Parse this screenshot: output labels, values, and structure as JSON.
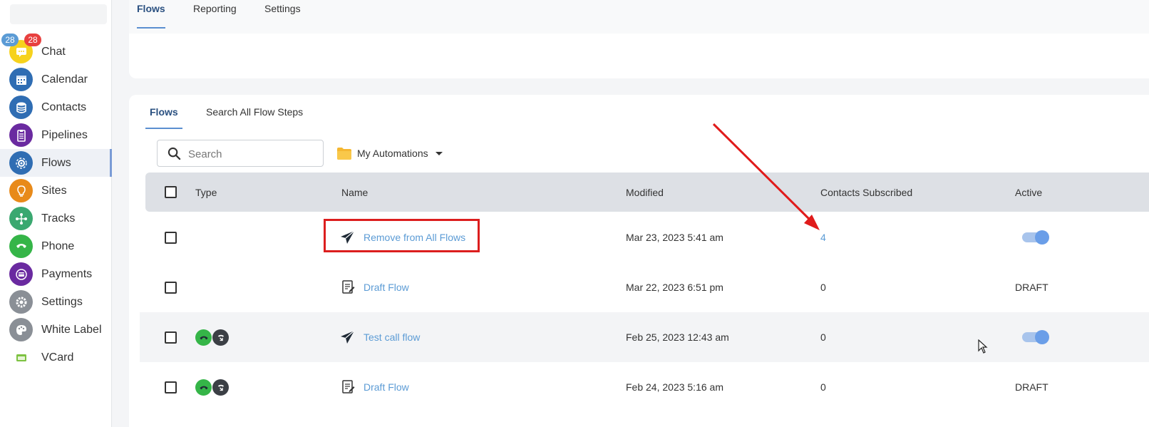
{
  "colors": {
    "accent": "#5b9bd5",
    "highlight": "#dc1e1e",
    "badge_red": "#e8403f",
    "badge_blue": "#5b9bd5"
  },
  "sidebar": {
    "badges": {
      "left": "28",
      "right": "28"
    },
    "items": [
      {
        "label": "Chat",
        "icon": "chat-icon",
        "color": "#f6d21d"
      },
      {
        "label": "Calendar",
        "icon": "calendar-icon",
        "color": "#2f6db3"
      },
      {
        "label": "Contacts",
        "icon": "database-icon",
        "color": "#2f6db3"
      },
      {
        "label": "Pipelines",
        "icon": "clipboard-icon",
        "color": "#6a2aa0"
      },
      {
        "label": "Flows",
        "icon": "gear-flow-icon",
        "color": "#2f6db3"
      },
      {
        "label": "Sites",
        "icon": "lightbulb-icon",
        "color": "#e88a1a"
      },
      {
        "label": "Tracks",
        "icon": "network-icon",
        "color": "#3aa870"
      },
      {
        "label": "Phone",
        "icon": "phone-icon",
        "color": "#35b548"
      },
      {
        "label": "Payments",
        "icon": "payment-icon",
        "color": "#6a2aa0"
      },
      {
        "label": "Settings",
        "icon": "settings-icon",
        "color": "#8a8f96"
      },
      {
        "label": "White Label",
        "icon": "palette-icon",
        "color": "#8a8f96"
      },
      {
        "label": "VCard",
        "icon": "card-icon",
        "color": "#7dc242"
      }
    ],
    "active_index": 4
  },
  "top_tabs": [
    {
      "label": "Flows",
      "active": true
    },
    {
      "label": "Reporting",
      "active": false
    },
    {
      "label": "Settings",
      "active": false
    }
  ],
  "sub_tabs": [
    {
      "label": "Flows",
      "active": true
    },
    {
      "label": "Search All Flow Steps",
      "active": false
    }
  ],
  "search": {
    "placeholder": "Search"
  },
  "folder": {
    "label": "My Automations"
  },
  "table": {
    "headers": [
      "Type",
      "Name",
      "Modified",
      "Contacts Subscribed",
      "Active"
    ],
    "rows": [
      {
        "type_icons": [],
        "name_icon": "send-icon",
        "name": "Remove from All Flows",
        "modified": "Mar 23, 2023 5:41 am",
        "contacts": "4",
        "active": "toggle-on",
        "active_text": ""
      },
      {
        "type_icons": [],
        "name_icon": "draft-icon",
        "name": "Draft Flow",
        "modified": "Mar 22, 2023 6:51 pm",
        "contacts": "0",
        "active": "text",
        "active_text": "DRAFT"
      },
      {
        "type_icons": [
          "phone-icon",
          "phone-arrow-icon"
        ],
        "name_icon": "send-icon",
        "name": "Test call flow",
        "modified": "Feb 25, 2023 12:43 am",
        "contacts": "0",
        "active": "toggle-on",
        "active_text": ""
      },
      {
        "type_icons": [
          "phone-icon",
          "phone-arrow-icon"
        ],
        "name_icon": "draft-icon",
        "name": "Draft Flow",
        "modified": "Feb 24, 2023 5:16 am",
        "contacts": "0",
        "active": "text",
        "active_text": "DRAFT"
      }
    ]
  }
}
